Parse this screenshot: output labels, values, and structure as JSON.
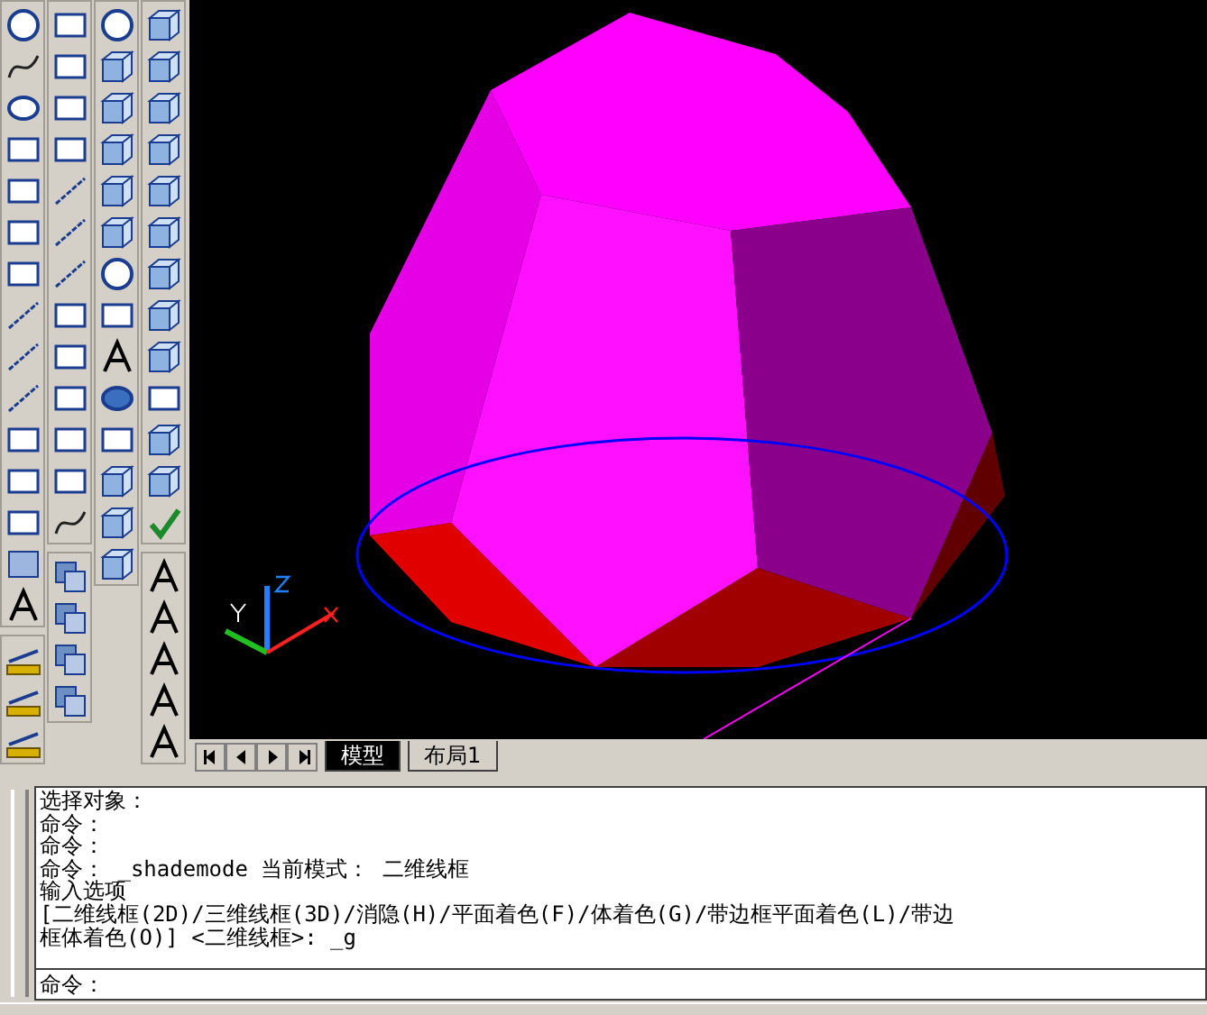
{
  "layout_tabs": [
    {
      "label": "模型",
      "selected": true
    },
    {
      "label": "布局1",
      "selected": false
    }
  ],
  "command_history": [
    "选择对象：",
    "命令：",
    "命令：",
    "命令： _shademode 当前模式： 二维线框",
    "输入选项",
    "[二维线框(2D)/三维线框(3D)/消隐(H)/平面着色(F)/体着色(G)/带边框平面着色(L)/带边",
    "框体着色(O)] <二维线框>: _g"
  ],
  "command_prompt": "命令："
}
